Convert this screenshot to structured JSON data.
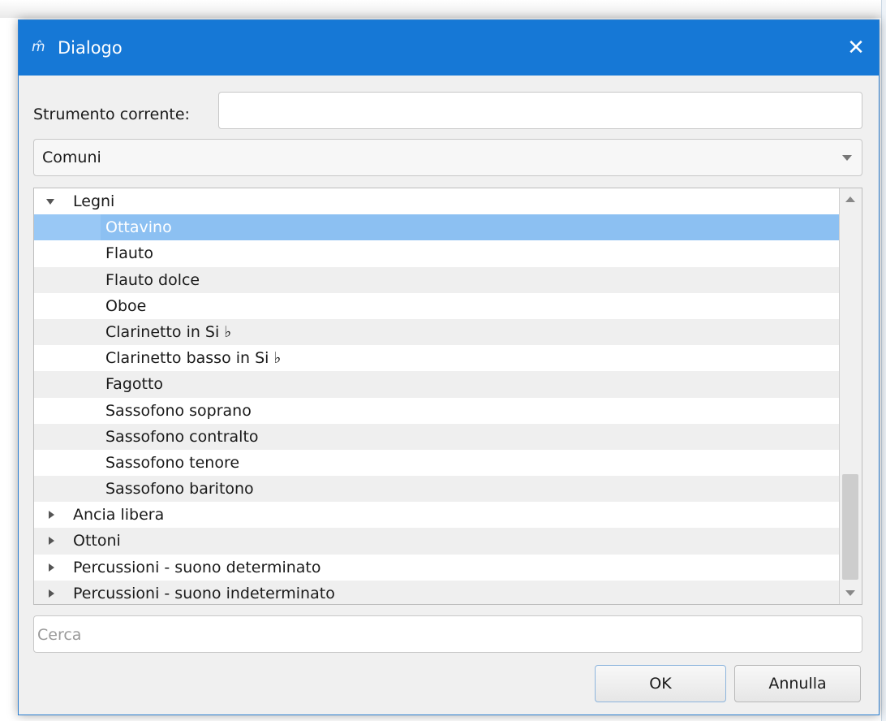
{
  "window": {
    "title": "Dialogo",
    "app_icon_glyph": "m̂",
    "close_glyph": "✕"
  },
  "form": {
    "current_instrument_label": "Strumento corrente:",
    "current_instrument_value": "",
    "category_selected": "Comuni",
    "search_placeholder": "Cerca",
    "search_value": ""
  },
  "tree": {
    "rows": [
      {
        "label": "Legni",
        "type": "category",
        "expanded": true
      },
      {
        "label": "Ottavino",
        "type": "leaf",
        "selected": true
      },
      {
        "label": "Flauto",
        "type": "leaf"
      },
      {
        "label": "Flauto dolce",
        "type": "leaf"
      },
      {
        "label": "Oboe",
        "type": "leaf"
      },
      {
        "label": "Clarinetto in Si ♭",
        "type": "leaf"
      },
      {
        "label": "Clarinetto basso in Si ♭",
        "type": "leaf"
      },
      {
        "label": "Fagotto",
        "type": "leaf"
      },
      {
        "label": "Sassofono soprano",
        "type": "leaf"
      },
      {
        "label": "Sassofono contralto",
        "type": "leaf"
      },
      {
        "label": "Sassofono tenore",
        "type": "leaf"
      },
      {
        "label": "Sassofono baritono",
        "type": "leaf"
      },
      {
        "label": "Ancia libera",
        "type": "category",
        "expanded": false
      },
      {
        "label": "Ottoni",
        "type": "category",
        "expanded": false
      },
      {
        "label": "Percussioni - suono determinato",
        "type": "category",
        "expanded": false
      },
      {
        "label": "Percussioni - suono indeterminato",
        "type": "category",
        "expanded": false
      }
    ]
  },
  "buttons": {
    "ok_label": "OK",
    "cancel_label": "Annulla"
  },
  "colors": {
    "titlebar": "#1678d6",
    "selection": "#99c8f5"
  }
}
